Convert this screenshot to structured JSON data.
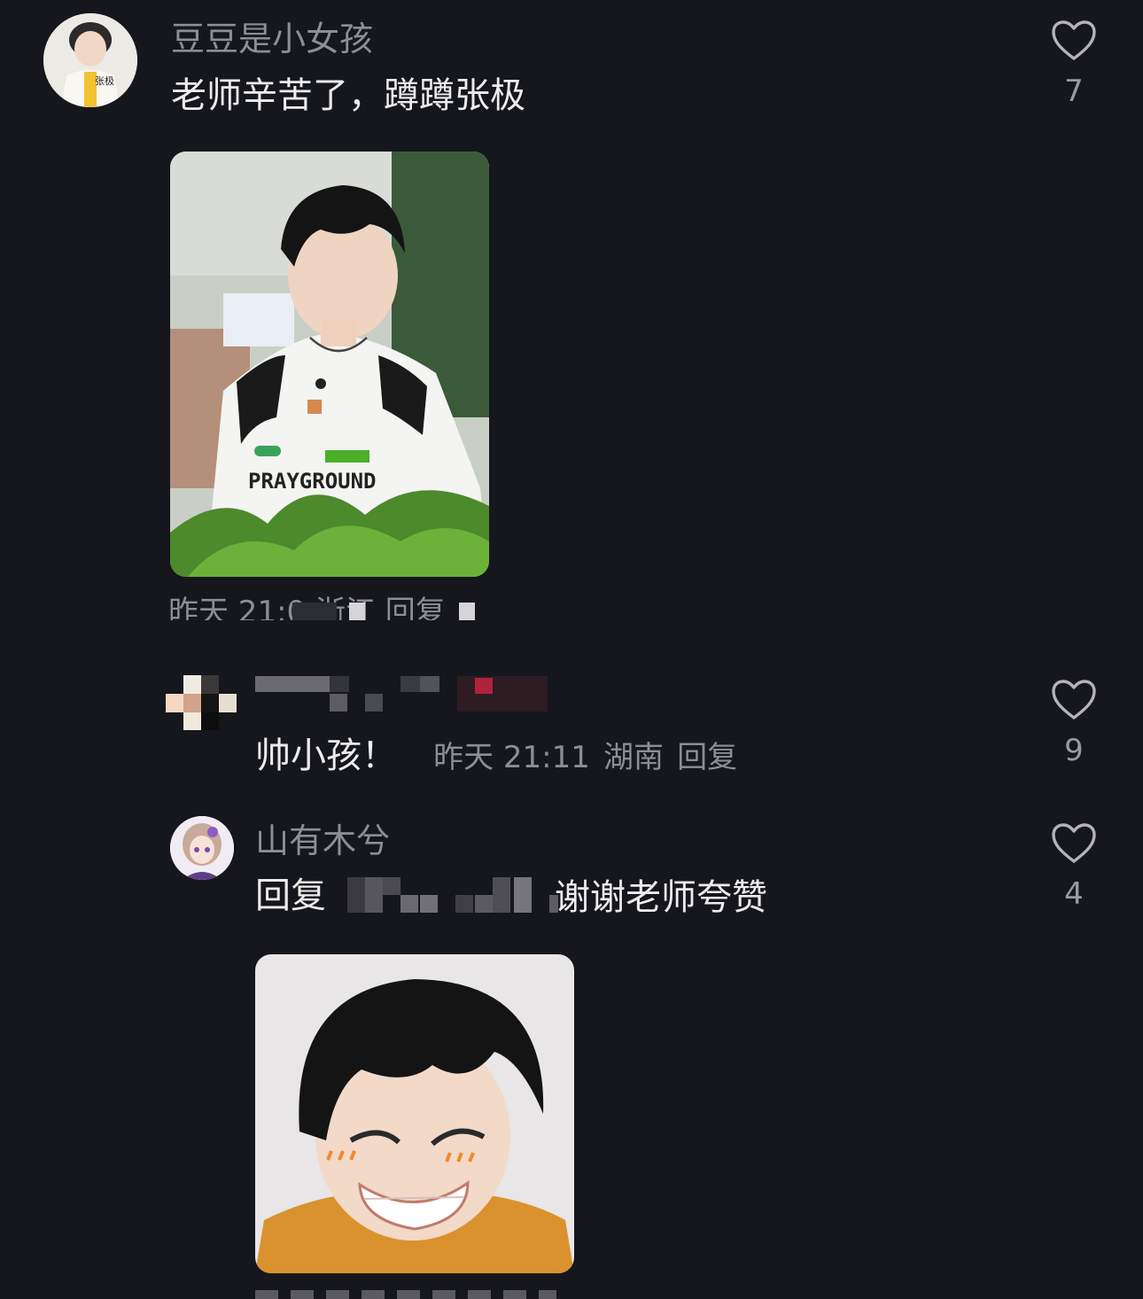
{
  "comments": [
    {
      "username": "豆豆是小女孩",
      "text": "老师辛苦了，蹲蹲张极",
      "likes": "7",
      "meta_time": "昨天 21:0",
      "meta_location": "浙江",
      "meta_reply": "回复",
      "photo_caption": "PRAYGROUND",
      "avatar_caption": "张极"
    },
    {
      "username": "",
      "text": "帅小孩！",
      "meta_time": "昨天 21:11",
      "meta_location": "湖南",
      "meta_reply": "回复",
      "likes": "9"
    },
    {
      "username": "山有木兮",
      "reply_prefix": "回复",
      "text": "谢谢老师夸赞",
      "likes": "4"
    }
  ],
  "icons": {
    "like": "heart-outline-icon"
  },
  "colors": {
    "background": "#16161d",
    "username": "#8d8d94",
    "text": "#ececec"
  }
}
